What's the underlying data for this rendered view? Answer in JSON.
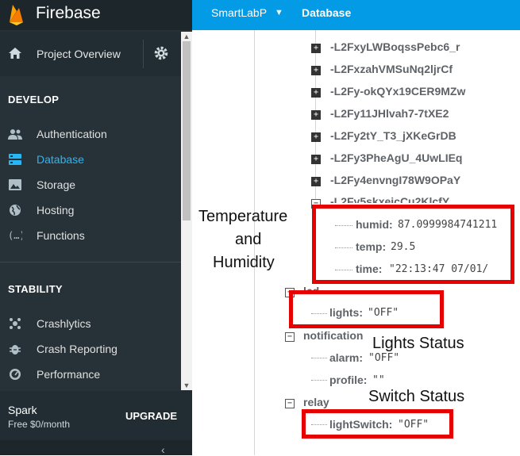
{
  "app": {
    "brand": "Firebase"
  },
  "topbar": {
    "project": "SmartLabP",
    "section": "Database"
  },
  "sidebar": {
    "overview_label": "Project Overview",
    "develop_title": "DEVELOP",
    "develop_items": [
      "Authentication",
      "Database",
      "Storage",
      "Hosting",
      "Functions"
    ],
    "stability_title": "STABILITY",
    "stability_items": [
      "Crashlytics",
      "Crash Reporting",
      "Performance"
    ],
    "plan": {
      "name": "Spark",
      "price": "Free $0/month",
      "upgrade": "UPGRADE"
    }
  },
  "tree": {
    "push_keys": [
      "-L2FxyLWBoqssPebc6_r",
      "-L2FxzahVMSuNq2ljrCf",
      "-L2Fy-okQYx19CER9MZw",
      "-L2Fy11JHlvah7-7tXE2",
      "-L2Fy2tY_T3_jXKeGrDB",
      "-L2Fy3PheAgU_4UwLIEq",
      "-L2Fy4envngI78W9OPaY",
      "-L2Fy5skxeicCu2KlcfY"
    ],
    "reading": {
      "humid_key": "humid:",
      "humid_val": "87.0999984741211",
      "temp_key": "temp:",
      "temp_val": "29.5",
      "time_key": "time:",
      "time_val": "\"22:13:47   07/01/"
    },
    "lcd": {
      "key": "lcd",
      "lights_key": "lights:",
      "lights_val": "\"OFF\""
    },
    "notification": {
      "key": "notification",
      "alarm_key": "alarm:",
      "alarm_val": "\"OFF\"",
      "profile_key": "profile:",
      "profile_val": "\"\""
    },
    "relay": {
      "key": "relay",
      "switch_key": "lightSwitch:",
      "switch_val": "\"OFF\""
    }
  },
  "annotations": {
    "temp_line1": "Temperature",
    "temp_line2": "and",
    "temp_line3": "Humidity",
    "lights": "Lights Status",
    "switch": "Switch Status"
  }
}
